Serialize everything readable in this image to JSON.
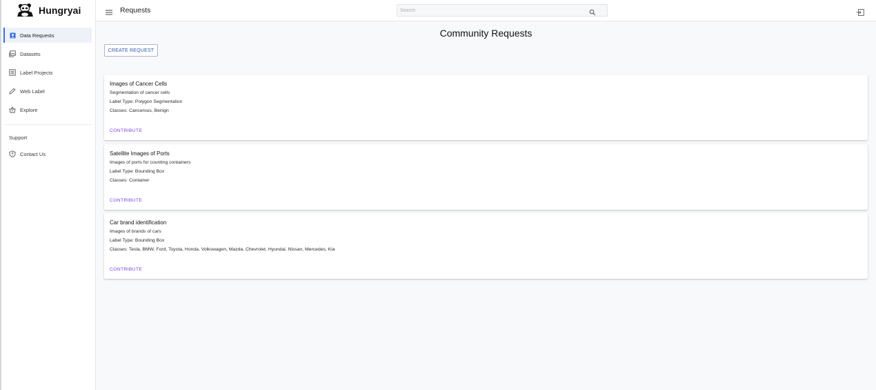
{
  "brand": {
    "name": "Hungryai"
  },
  "sidebar": {
    "items": [
      {
        "label": "Data Requests",
        "icon": "person-badge-icon",
        "active": true
      },
      {
        "label": "Datasets",
        "icon": "image-stack-icon"
      },
      {
        "label": "Label Projects",
        "icon": "list-icon"
      },
      {
        "label": "Web Label",
        "icon": "pencil-icon"
      },
      {
        "label": "Explore",
        "icon": "basket-icon"
      }
    ],
    "support_label": "Support",
    "support_items": [
      {
        "label": "Contact Us",
        "icon": "help-shield-icon"
      }
    ]
  },
  "header": {
    "title": "Requests",
    "search_placeholder": "Search"
  },
  "main": {
    "title": "Community Requests",
    "create_button": "CREATE REQUEST",
    "requests": [
      {
        "title": "Images of Cancer Cells",
        "description": "Segmentation of cancer cells",
        "label_type": "Label Type: Polygon Segmentation",
        "classes": "Classes: Cancerous, Benign",
        "action": "CONTRIBUTE"
      },
      {
        "title": "Satellite Images of Ports",
        "description": "Images of ports for counting containers",
        "label_type": "Label Type: Bounding Box",
        "classes": "Classes: Container",
        "action": "CONTRIBUTE"
      },
      {
        "title": "Car brand identification",
        "description": "Images of brands of cars",
        "label_type": "Label Type: Bounding Box",
        "classes": "Classes: Tesla, BMW, Ford, Toyota, Honda, Volkswagen, Mazda, Chevrolet, Hyundai, Nissan, Mercedes, Kia",
        "action": "CONTRIBUTE"
      }
    ]
  },
  "colors": {
    "accent": "#3b6fd8",
    "contribute": "#7b3fe4",
    "button_text": "#2f5aa8",
    "background": "#f8f9fb"
  }
}
